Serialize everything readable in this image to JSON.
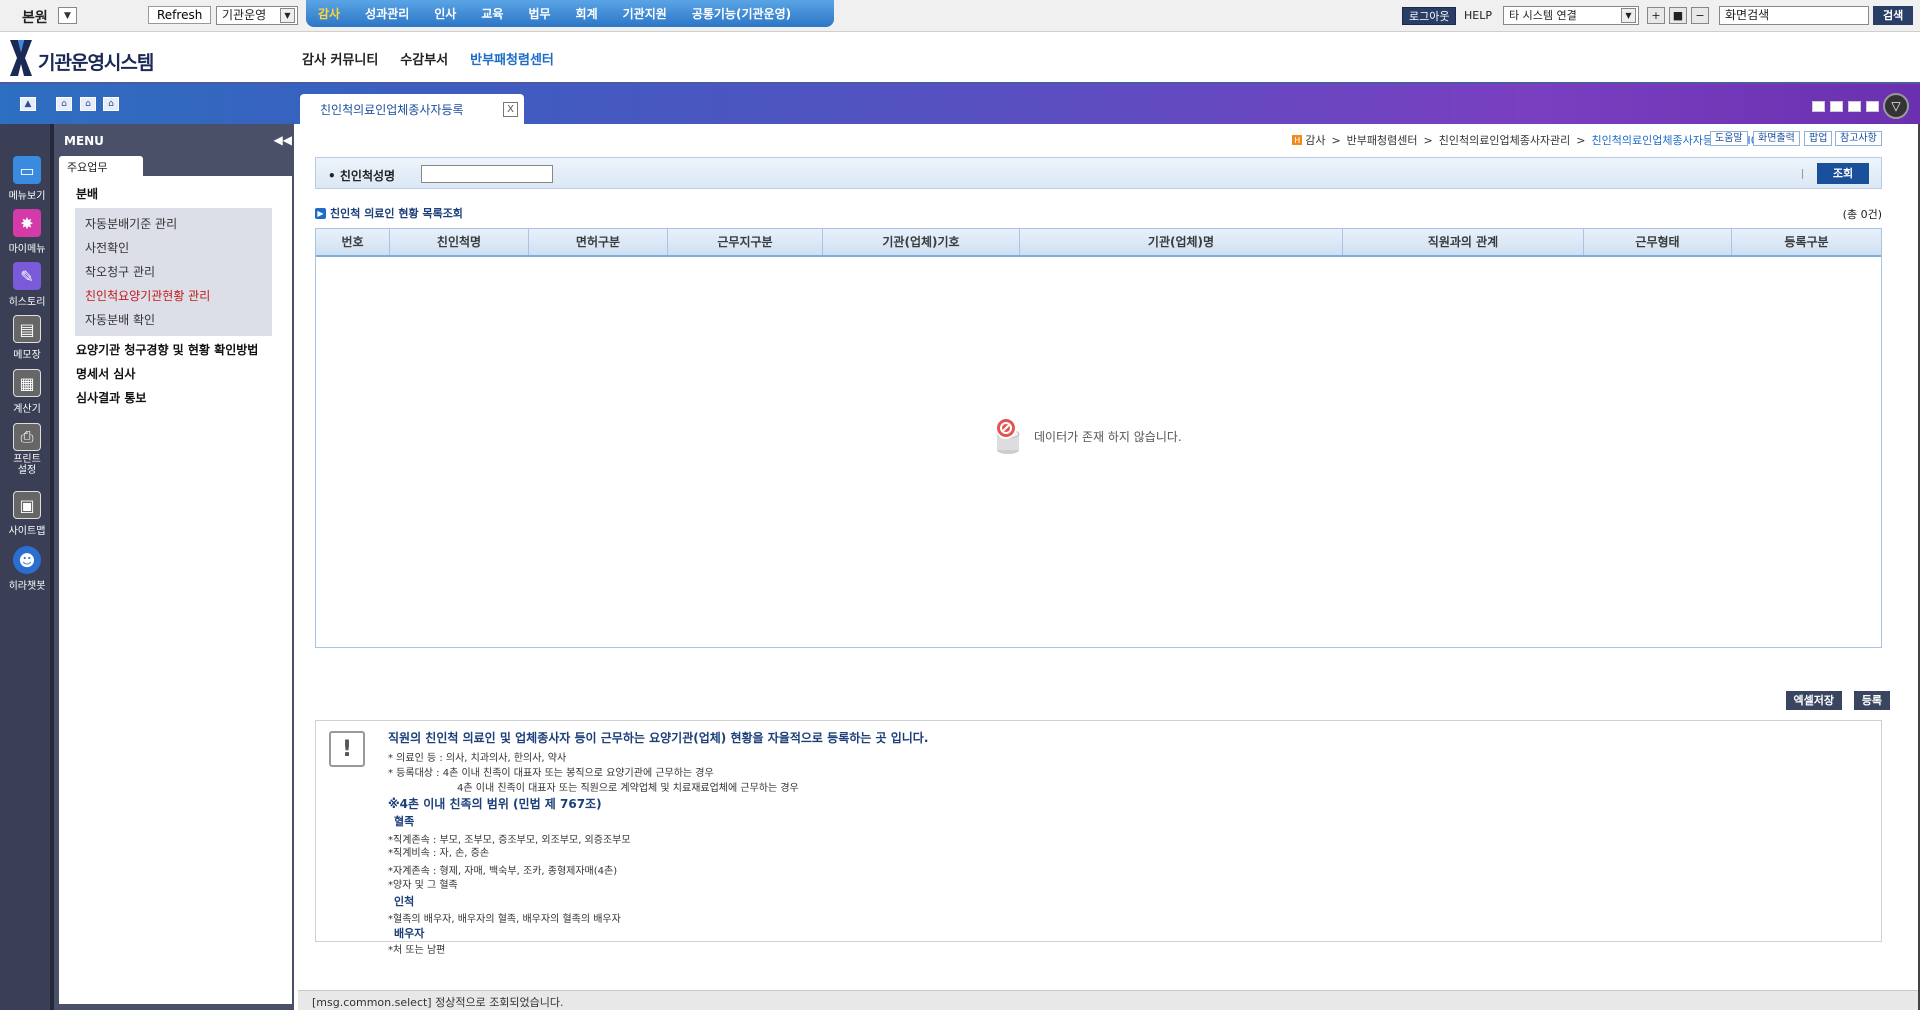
{
  "topbar": {
    "org_name": "본원",
    "refresh_label": "Refresh",
    "system_select": "기관운영",
    "nav": [
      {
        "label": "감사",
        "active": true
      },
      {
        "label": "성과관리"
      },
      {
        "label": "인사"
      },
      {
        "label": "교육"
      },
      {
        "label": "법무"
      },
      {
        "label": "회계"
      },
      {
        "label": "기관지원"
      },
      {
        "label": "공통기능(기관운영)"
      }
    ],
    "logout_label": "로그아웃",
    "help_label": "HELP",
    "system_link": "타 시스템 연결",
    "zoom_in": "+",
    "zoom_reset": "■",
    "zoom_out": "−",
    "screen_search_value": "화면검색",
    "search_label": "검색"
  },
  "header": {
    "logo_text": "기관운영시스템",
    "subnav": [
      {
        "label": "감사 커뮤니티"
      },
      {
        "label": "수감부서"
      },
      {
        "label": "반부패청렴센터",
        "active": true
      }
    ]
  },
  "tabbar": {
    "active_tab": "친인척의료인업체종사자등록",
    "close_label": "X"
  },
  "quickbar": [
    {
      "label": "메뉴보기",
      "icon": "monitor-icon"
    },
    {
      "label": "마이메뉴",
      "icon": "star-icon"
    },
    {
      "label": "히스토리",
      "icon": "pencil-icon"
    },
    {
      "label": "메모장",
      "icon": "memo-icon"
    },
    {
      "label": "계산기",
      "icon": "calculator-icon"
    },
    {
      "label": "프린트 설정",
      "icon": "printer-icon"
    },
    {
      "label": "사이트맵",
      "icon": "sitemap-icon"
    },
    {
      "label": "히라챗봇",
      "icon": "chatbot-icon"
    }
  ],
  "menu": {
    "title": "MENU",
    "tab_label": "주요업무",
    "section": "분배",
    "items": [
      {
        "label": "자동분배기준 관리"
      },
      {
        "label": "사전확인"
      },
      {
        "label": "착오청구 관리"
      },
      {
        "label": "친인척요양기관현황 관리",
        "active": true
      },
      {
        "label": "자동분배 확인"
      }
    ],
    "groups": [
      {
        "label": "요양기관 청구경향 및 현황 확인방법"
      },
      {
        "label": "명세서 심사"
      },
      {
        "label": "심사결과 통보"
      }
    ]
  },
  "breadcrumb": {
    "items": [
      "감사",
      "반부패청렴센터",
      "친인척의료인업체종사자관리"
    ],
    "current": "친인척의료인업체종사자등록(BAH001)"
  },
  "toplinks": [
    "도움말",
    "화면출력",
    "팝업",
    "참고사항"
  ],
  "search": {
    "label": "친인척성명",
    "value": "",
    "query_label": "조회"
  },
  "list": {
    "title": "친인척 의료인 현황 목록조회",
    "total": "(총 0건)",
    "columns": [
      "번호",
      "친인척명",
      "면허구분",
      "근무지구분",
      "기관(업체)기호",
      "기관(업체)명",
      "직원과의 관계",
      "근무형태",
      "등록구분"
    ],
    "rows": [],
    "empty_message": "데이터가 존재 하지 않습니다."
  },
  "actions": {
    "excel_label": "엑셀저장",
    "register_label": "등록"
  },
  "info": {
    "main": "직원의 친인척 의료인 및 업체종사자 등이 근무하는 요양기관(업체) 현황을 자율적으로 등록하는 곳 입니다.",
    "lines": [
      "* 의료인 등 : 의사, 치과의사, 한의사, 약사",
      "* 등록대상  : 4촌 이내 친족이 대표자 또는 봉직으로 요양기관에 근무하는 경우",
      "4촌 이내 친족이 대표자 또는 직원으로 계약업체 및 치료재료업체에 근무하는 경우"
    ],
    "range_title": "※4촌 이내 친족의 범위 (민법 제 767조)",
    "blood_title": "혈족",
    "blood_lines": [
      "*직계존속  : 부모, 조부모, 증조부모, 외조부모, 외증조부모",
      "*직계비속  : 자, 손, 증손",
      "*자계존속  : 형제, 자매, 백숙부, 조카, 종형제자매(4촌)",
      "*양자 및 그 혈족"
    ],
    "inlaw_title": "인척",
    "inlaw_lines": [
      "*혈족의 배우자, 배우자의 혈족, 배우자의 혈족의 배우자"
    ],
    "spouse_title": "배우자",
    "spouse_lines": [
      "*처 또는 남편"
    ]
  },
  "status": {
    "message": "[msg.common.select] 정상적으로 조회되었습니다."
  }
}
